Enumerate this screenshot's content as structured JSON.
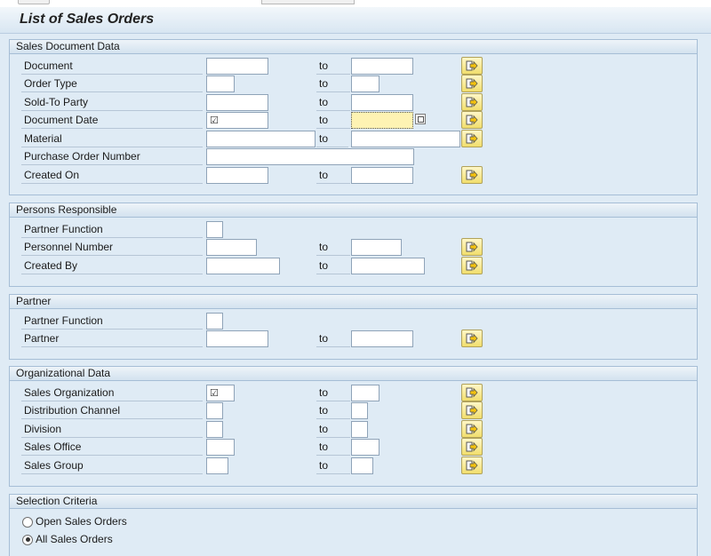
{
  "page_title": "List of Sales Orders",
  "to_label": "to",
  "groups": {
    "sales_doc": {
      "title": "Sales Document Data",
      "rows": [
        {
          "label": "Document"
        },
        {
          "label": "Order Type"
        },
        {
          "label": "Sold-To Party"
        },
        {
          "label": "Document Date"
        },
        {
          "label": "Material"
        },
        {
          "label": "Purchase Order Number"
        },
        {
          "label": "Created On"
        }
      ]
    },
    "persons": {
      "title": "Persons Responsible",
      "rows": [
        {
          "label": "Partner Function"
        },
        {
          "label": "Personnel Number"
        },
        {
          "label": "Created By"
        }
      ]
    },
    "partner": {
      "title": "Partner",
      "rows": [
        {
          "label": "Partner Function"
        },
        {
          "label": "Partner"
        }
      ]
    },
    "org": {
      "title": "Organizational Data",
      "rows": [
        {
          "label": "Sales Organization"
        },
        {
          "label": "Distribution Channel"
        },
        {
          "label": "Division"
        },
        {
          "label": "Sales Office"
        },
        {
          "label": "Sales Group"
        }
      ]
    },
    "selection": {
      "title": "Selection Criteria",
      "options": [
        {
          "label": "Open Sales Orders",
          "selected": false
        },
        {
          "label": "All Sales Orders",
          "selected": true
        }
      ]
    }
  },
  "checkbox_glyph": "☑",
  "colors": {
    "highlight_field": "#fef3b3",
    "group_bg": "#dfebf5",
    "multi_select_button": "#f1de6c"
  }
}
